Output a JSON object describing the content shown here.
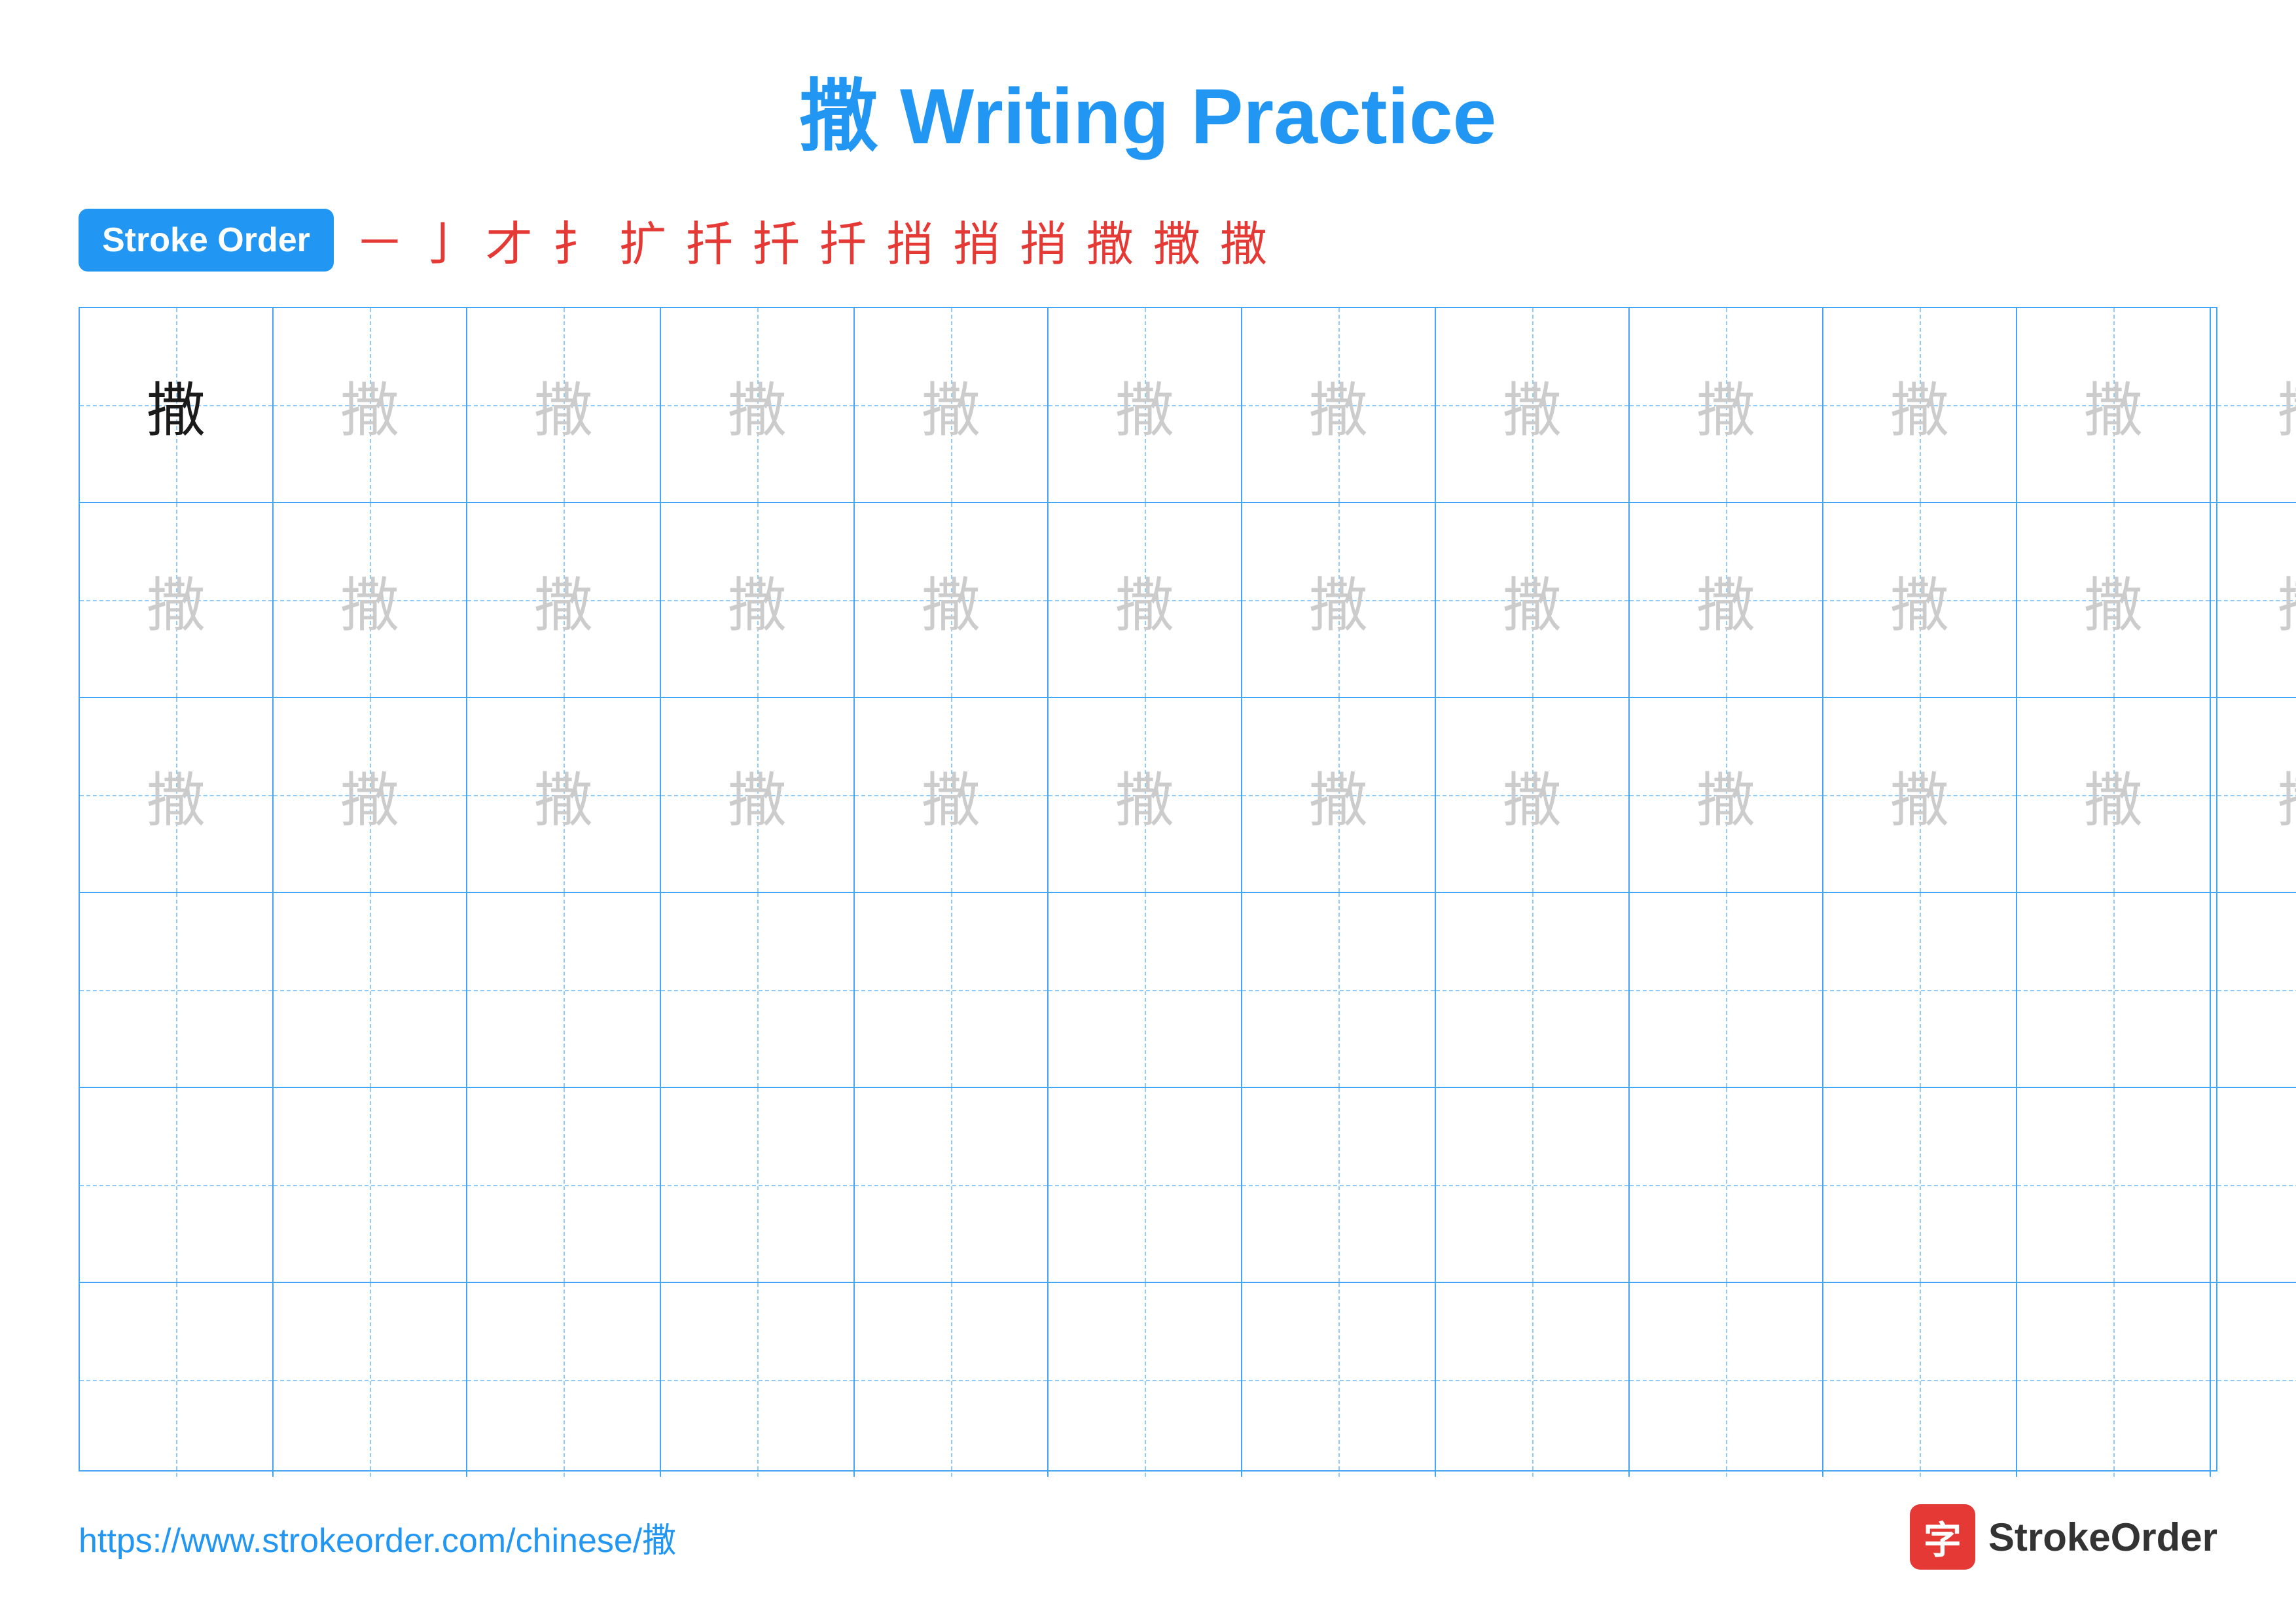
{
  "title": {
    "character": "撒",
    "text": "Writing Practice",
    "full": "撒 Writing Practice"
  },
  "stroke_order": {
    "badge_label": "Stroke Order",
    "chars": [
      "-",
      "亅",
      "才",
      "扌",
      "扩",
      "扦",
      "扦",
      "扦",
      "捎",
      "捎",
      "捎",
      "捎'",
      "撒'",
      "撒",
      "撒"
    ]
  },
  "grid": {
    "rows": 6,
    "cols": 13,
    "char": "撒",
    "row1_dark_count": 1,
    "row1_light_count": 12,
    "row2_light_count": 13,
    "row3_light_count": 13,
    "row4_empty": true,
    "row5_empty": true,
    "row6_empty": true
  },
  "footer": {
    "url": "https://www.strokeorder.com/chinese/撒",
    "logo_char": "字",
    "logo_text": "StrokeOrder"
  }
}
